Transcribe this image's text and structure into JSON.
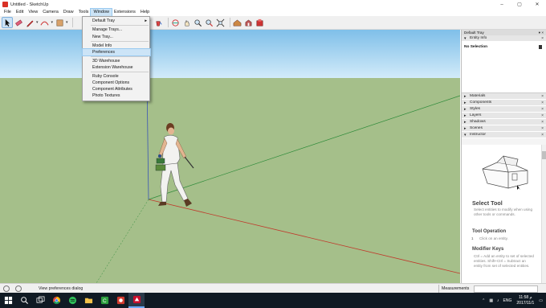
{
  "titlebar": {
    "title": "Untitled - SketchUp",
    "minimize": "–",
    "maximize": "▢",
    "close": "✕"
  },
  "menubar": {
    "items": [
      "File",
      "Edit",
      "View",
      "Camera",
      "Draw",
      "Tools",
      "Window",
      "Extensions",
      "Help"
    ]
  },
  "window_menu": {
    "items": [
      {
        "label": "Default Tray",
        "submenu": "►"
      },
      {
        "label": "Manage Trays..."
      },
      {
        "label": "New Tray..."
      },
      {
        "label": "Model Info"
      },
      {
        "label": "Preferences"
      },
      {
        "label": "3D Warehouse"
      },
      {
        "label": "Extension Warehouse"
      },
      {
        "label": "Ruby Console"
      },
      {
        "label": "Component Options"
      },
      {
        "label": "Component Attributes"
      },
      {
        "label": "Photo Textures"
      }
    ]
  },
  "tray": {
    "title": "Default Tray",
    "controls": "▾ ×",
    "entity_info": {
      "label": "Entity Info",
      "value": "No Selection"
    },
    "panels": [
      "Materials",
      "Components",
      "Styles",
      "Layers",
      "Shadows",
      "Scenes",
      "Instructor"
    ],
    "instructor": {
      "title": "Select Tool",
      "description": "Select entities to modify when using other tools or commands.",
      "operation_heading": "Tool Operation",
      "operation_step": "1",
      "operation_text": "Click on an entity.",
      "modifier_heading": "Modifier Keys",
      "modifier_text": "Ctrl = Add an entity to set of selected entities. Shift+Ctrl = Subtract an entity from set of selected entities."
    }
  },
  "statusbar": {
    "hint": "View preferences dialog",
    "measurements_label": "Measurements"
  },
  "taskbar": {
    "lang": "ENG",
    "time": "11:58 م",
    "date": "2017/11/1"
  },
  "colors": {
    "sky_top": "#7fbfe9",
    "ground": "#a5bf8a",
    "red_axis": "#c0392b",
    "green_axis": "#2e8b3a",
    "blue_axis": "#3a55b5",
    "menu_highlight": "#cce4f7",
    "taskbar": "#101a24"
  },
  "icons": [
    "select-arrow-icon",
    "eraser-icon",
    "pencil-icon",
    "arc-icon",
    "push-pull-icon",
    "orbit-icon",
    "pan-icon",
    "zoom-icon",
    "zoom-extents-icon",
    "warehouse-icon",
    "extension-icon",
    "start-icon",
    "search-icon",
    "task-view-icon",
    "chrome-icon",
    "spotify-icon",
    "folder-icon",
    "camtasia-icon",
    "recorder-icon",
    "sketchup-icon"
  ]
}
